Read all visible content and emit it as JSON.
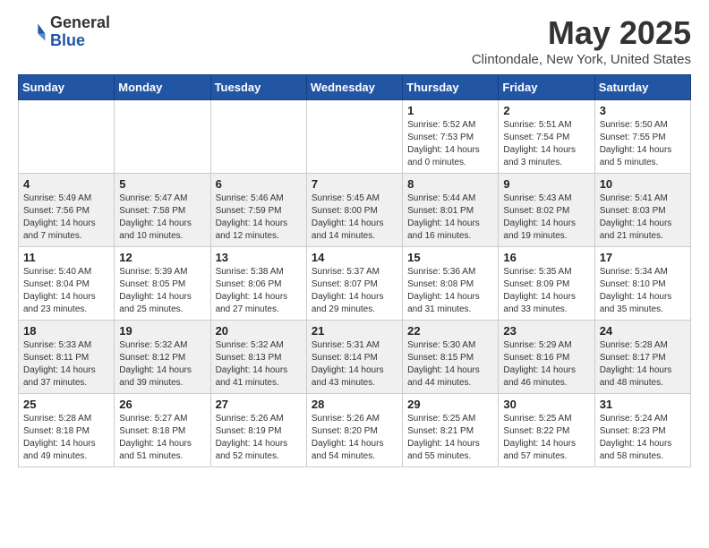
{
  "header": {
    "logo_general": "General",
    "logo_blue": "Blue",
    "title": "May 2025",
    "subtitle": "Clintondale, New York, United States"
  },
  "days_of_week": [
    "Sunday",
    "Monday",
    "Tuesday",
    "Wednesday",
    "Thursday",
    "Friday",
    "Saturday"
  ],
  "weeks": [
    [
      {
        "day": "",
        "info": ""
      },
      {
        "day": "",
        "info": ""
      },
      {
        "day": "",
        "info": ""
      },
      {
        "day": "",
        "info": ""
      },
      {
        "day": "1",
        "info": "Sunrise: 5:52 AM\nSunset: 7:53 PM\nDaylight: 14 hours and 0 minutes."
      },
      {
        "day": "2",
        "info": "Sunrise: 5:51 AM\nSunset: 7:54 PM\nDaylight: 14 hours and 3 minutes."
      },
      {
        "day": "3",
        "info": "Sunrise: 5:50 AM\nSunset: 7:55 PM\nDaylight: 14 hours and 5 minutes."
      }
    ],
    [
      {
        "day": "4",
        "info": "Sunrise: 5:49 AM\nSunset: 7:56 PM\nDaylight: 14 hours and 7 minutes."
      },
      {
        "day": "5",
        "info": "Sunrise: 5:47 AM\nSunset: 7:58 PM\nDaylight: 14 hours and 10 minutes."
      },
      {
        "day": "6",
        "info": "Sunrise: 5:46 AM\nSunset: 7:59 PM\nDaylight: 14 hours and 12 minutes."
      },
      {
        "day": "7",
        "info": "Sunrise: 5:45 AM\nSunset: 8:00 PM\nDaylight: 14 hours and 14 minutes."
      },
      {
        "day": "8",
        "info": "Sunrise: 5:44 AM\nSunset: 8:01 PM\nDaylight: 14 hours and 16 minutes."
      },
      {
        "day": "9",
        "info": "Sunrise: 5:43 AM\nSunset: 8:02 PM\nDaylight: 14 hours and 19 minutes."
      },
      {
        "day": "10",
        "info": "Sunrise: 5:41 AM\nSunset: 8:03 PM\nDaylight: 14 hours and 21 minutes."
      }
    ],
    [
      {
        "day": "11",
        "info": "Sunrise: 5:40 AM\nSunset: 8:04 PM\nDaylight: 14 hours and 23 minutes."
      },
      {
        "day": "12",
        "info": "Sunrise: 5:39 AM\nSunset: 8:05 PM\nDaylight: 14 hours and 25 minutes."
      },
      {
        "day": "13",
        "info": "Sunrise: 5:38 AM\nSunset: 8:06 PM\nDaylight: 14 hours and 27 minutes."
      },
      {
        "day": "14",
        "info": "Sunrise: 5:37 AM\nSunset: 8:07 PM\nDaylight: 14 hours and 29 minutes."
      },
      {
        "day": "15",
        "info": "Sunrise: 5:36 AM\nSunset: 8:08 PM\nDaylight: 14 hours and 31 minutes."
      },
      {
        "day": "16",
        "info": "Sunrise: 5:35 AM\nSunset: 8:09 PM\nDaylight: 14 hours and 33 minutes."
      },
      {
        "day": "17",
        "info": "Sunrise: 5:34 AM\nSunset: 8:10 PM\nDaylight: 14 hours and 35 minutes."
      }
    ],
    [
      {
        "day": "18",
        "info": "Sunrise: 5:33 AM\nSunset: 8:11 PM\nDaylight: 14 hours and 37 minutes."
      },
      {
        "day": "19",
        "info": "Sunrise: 5:32 AM\nSunset: 8:12 PM\nDaylight: 14 hours and 39 minutes."
      },
      {
        "day": "20",
        "info": "Sunrise: 5:32 AM\nSunset: 8:13 PM\nDaylight: 14 hours and 41 minutes."
      },
      {
        "day": "21",
        "info": "Sunrise: 5:31 AM\nSunset: 8:14 PM\nDaylight: 14 hours and 43 minutes."
      },
      {
        "day": "22",
        "info": "Sunrise: 5:30 AM\nSunset: 8:15 PM\nDaylight: 14 hours and 44 minutes."
      },
      {
        "day": "23",
        "info": "Sunrise: 5:29 AM\nSunset: 8:16 PM\nDaylight: 14 hours and 46 minutes."
      },
      {
        "day": "24",
        "info": "Sunrise: 5:28 AM\nSunset: 8:17 PM\nDaylight: 14 hours and 48 minutes."
      }
    ],
    [
      {
        "day": "25",
        "info": "Sunrise: 5:28 AM\nSunset: 8:18 PM\nDaylight: 14 hours and 49 minutes."
      },
      {
        "day": "26",
        "info": "Sunrise: 5:27 AM\nSunset: 8:18 PM\nDaylight: 14 hours and 51 minutes."
      },
      {
        "day": "27",
        "info": "Sunrise: 5:26 AM\nSunset: 8:19 PM\nDaylight: 14 hours and 52 minutes."
      },
      {
        "day": "28",
        "info": "Sunrise: 5:26 AM\nSunset: 8:20 PM\nDaylight: 14 hours and 54 minutes."
      },
      {
        "day": "29",
        "info": "Sunrise: 5:25 AM\nSunset: 8:21 PM\nDaylight: 14 hours and 55 minutes."
      },
      {
        "day": "30",
        "info": "Sunrise: 5:25 AM\nSunset: 8:22 PM\nDaylight: 14 hours and 57 minutes."
      },
      {
        "day": "31",
        "info": "Sunrise: 5:24 AM\nSunset: 8:23 PM\nDaylight: 14 hours and 58 minutes."
      }
    ]
  ]
}
